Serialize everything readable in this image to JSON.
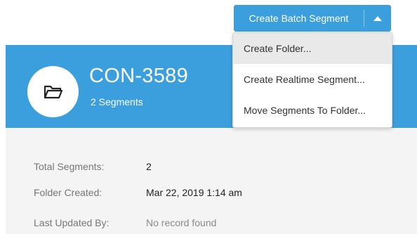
{
  "header": {
    "folder_name": "CON-3589",
    "segment_count": "2 Segments",
    "more_glyph": ",",
    "icon": "folder-icon"
  },
  "details": {
    "total_segments_label": "Total Segments:",
    "total_segments_value": "2",
    "folder_created_label": "Folder Created:",
    "folder_created_value": "Mar 22, 2019 1:14 am",
    "last_updated_label": "Last Updated By:",
    "last_updated_value": "No record found"
  },
  "actions": {
    "create_batch_segment_label": "Create Batch Segment",
    "toggle_icon": "caret-up-icon",
    "menu_items": [
      {
        "label": "Create Folder..."
      },
      {
        "label": "Create Realtime Segment..."
      },
      {
        "label": "Move Segments To Folder..."
      }
    ]
  },
  "colors": {
    "primary": "#3b9fde",
    "panel_bg": "#f4f4f4",
    "menu_hover": "#e9e9e9"
  }
}
